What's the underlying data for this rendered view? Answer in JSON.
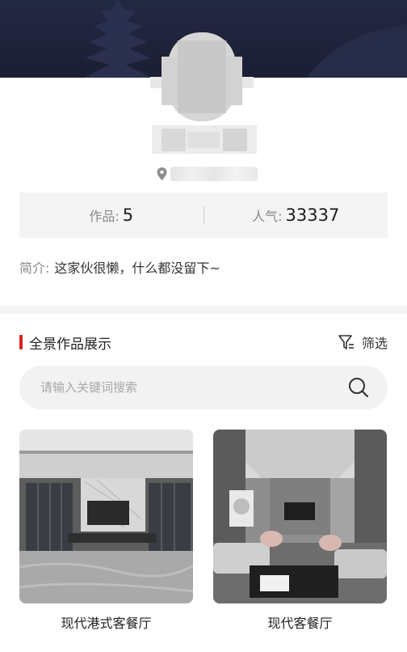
{
  "profile": {
    "location_icon": "map-pin-icon"
  },
  "stats": {
    "works_label": "作品:",
    "works_value": "5",
    "popularity_label": "人气:",
    "popularity_value": "33337"
  },
  "bio": {
    "label": "简介:",
    "text": "这家伙很懒，什么都没留下~"
  },
  "section": {
    "title": "全景作品展示",
    "filter_label": "筛选",
    "filter_icon": "filter-icon",
    "accent_color": "#d9251c"
  },
  "search": {
    "placeholder": "请输入关键词搜索",
    "value": "",
    "icon": "search-icon"
  },
  "works": [
    {
      "title": "现代港式客餐厅"
    },
    {
      "title": "现代客餐厅"
    }
  ]
}
